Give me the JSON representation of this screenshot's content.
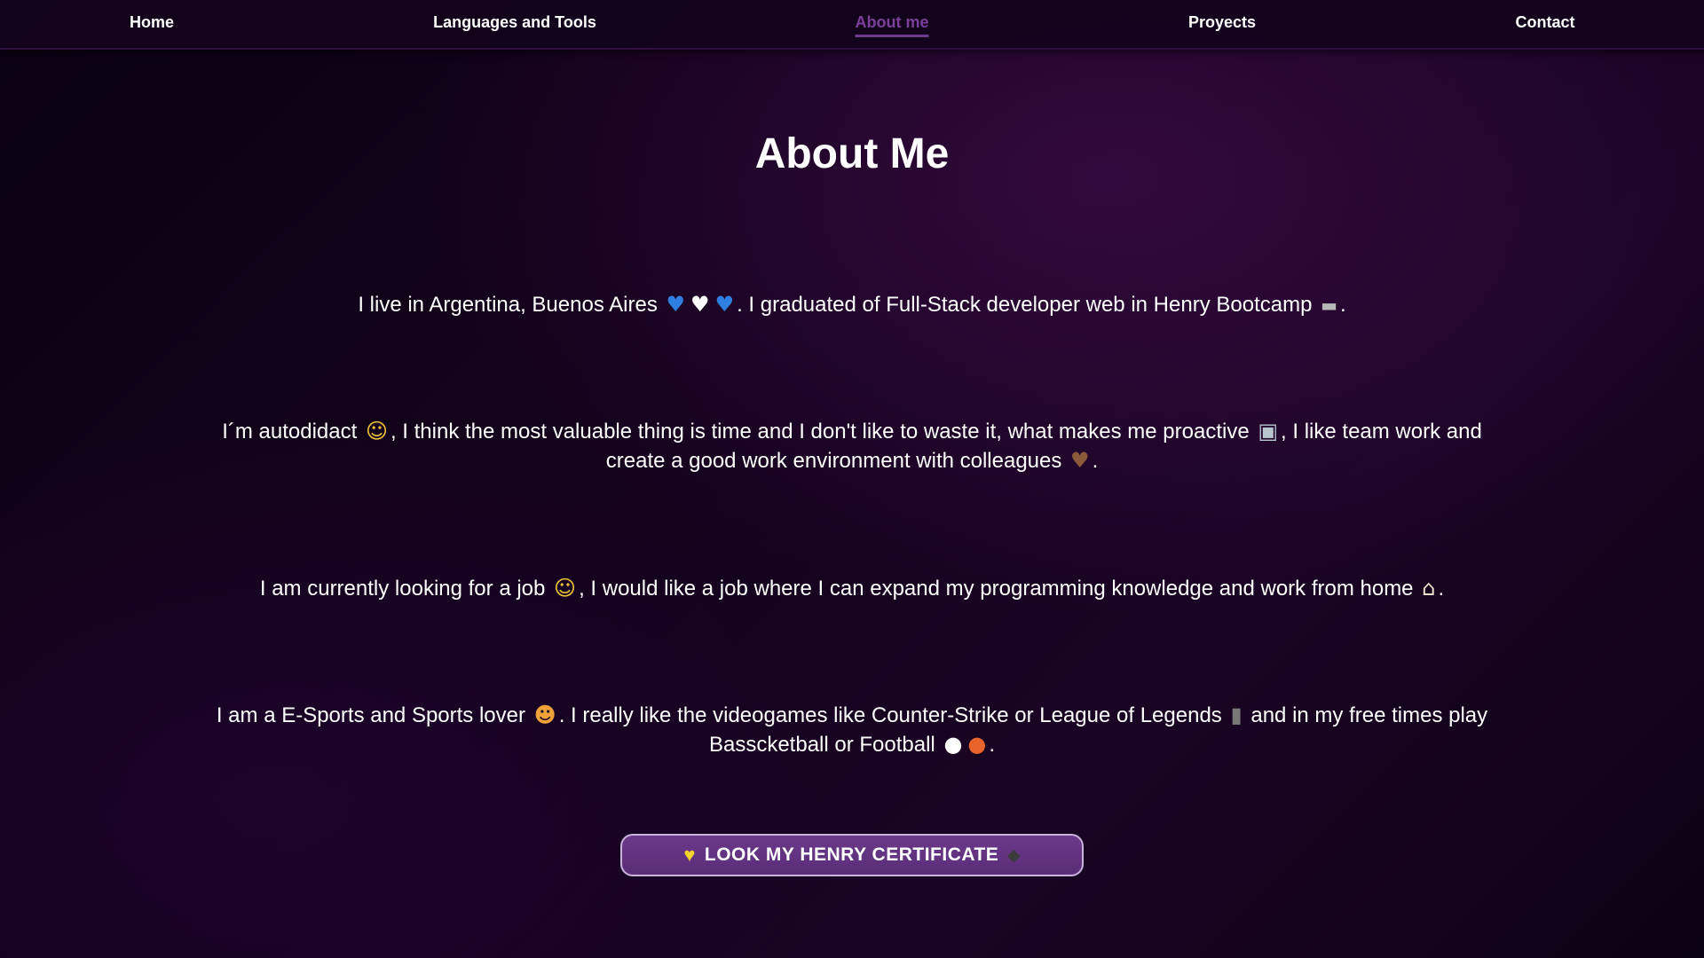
{
  "nav": {
    "items": [
      {
        "label": "Home",
        "active": false
      },
      {
        "label": "Languages and Tools",
        "active": false
      },
      {
        "label": "About me",
        "active": true
      },
      {
        "label": "Proyects",
        "active": false
      },
      {
        "label": "Contact",
        "active": false
      }
    ],
    "active_color": "#7a3f9a"
  },
  "about": {
    "title": "About Me",
    "p1": {
      "a": "I live in Argentina, Buenos Aires",
      "b": ". I graduated of Full-Stack developer web in Henry Bootcamp",
      "c": ".",
      "icons": [
        "blue-heart-icon",
        "white-heart-icon",
        "blue-heart-icon",
        "laptop-icon"
      ]
    },
    "p2": {
      "a": "I´m autodidact",
      "b": ", I think the most valuable thing is time and I don't like to waste it, what makes me proactive",
      "c": ", I like team work and create a good work environment with colleagues",
      "d": ".",
      "icons": [
        "nerd-face-icon",
        "robot-icon",
        "handshake-icon"
      ]
    },
    "p3": {
      "a": "I am currently looking for a job",
      "b": ", I would like a job where I can expand my programming knowledge and work from home",
      "c": ".",
      "icons": [
        "monocle-face-icon",
        "house-icon"
      ]
    },
    "p4": {
      "a": "I am a E-Sports and Sports lover",
      "b": ". I really like the videogames like Counter-Strike or League of Legends",
      "c": "and in my free times play Basscketball or Football",
      "d": ".",
      "icons": [
        "heart-eyes-cat-icon",
        "game-controller-icon",
        "soccer-ball-icon",
        "basketball-icon"
      ]
    }
  },
  "certificate_button": {
    "label": "LOOK MY HENRY CERTIFICATE",
    "icons": [
      "yellow-heart-icon",
      "graduation-cap-icon"
    ],
    "color": "#5f3180"
  }
}
